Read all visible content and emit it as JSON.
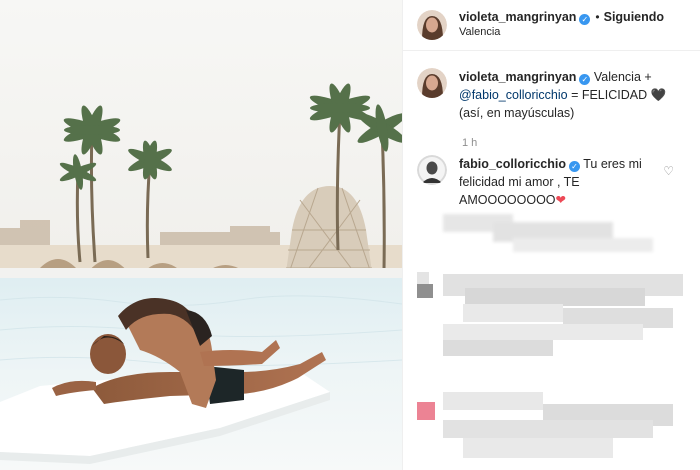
{
  "post": {
    "author": "violeta_mangrinyan",
    "status_separator": "•",
    "follow_label": "Siguiendo",
    "location": "Valencia"
  },
  "caption": {
    "author": "violeta_mangrinyan",
    "text_part1": "Valencia +",
    "mention": "@fabio_colloricchio",
    "text_part2": "= FELICIDAD",
    "heart": "🖤",
    "line2": "(así, en mayúsculas)",
    "time": "1 h"
  },
  "comment": {
    "author": "fabio_colloricchio",
    "text": "Tu eres mi felicidad mi amor , TE AMOOOOOOOO",
    "heart": "❤"
  },
  "colors": {
    "verified": "#3897f0",
    "mention": "#00376b",
    "muted": "#8e8e8e",
    "heart": "#ed4956"
  },
  "icons": [
    "verified-badge-icon",
    "like-heart-icon"
  ]
}
